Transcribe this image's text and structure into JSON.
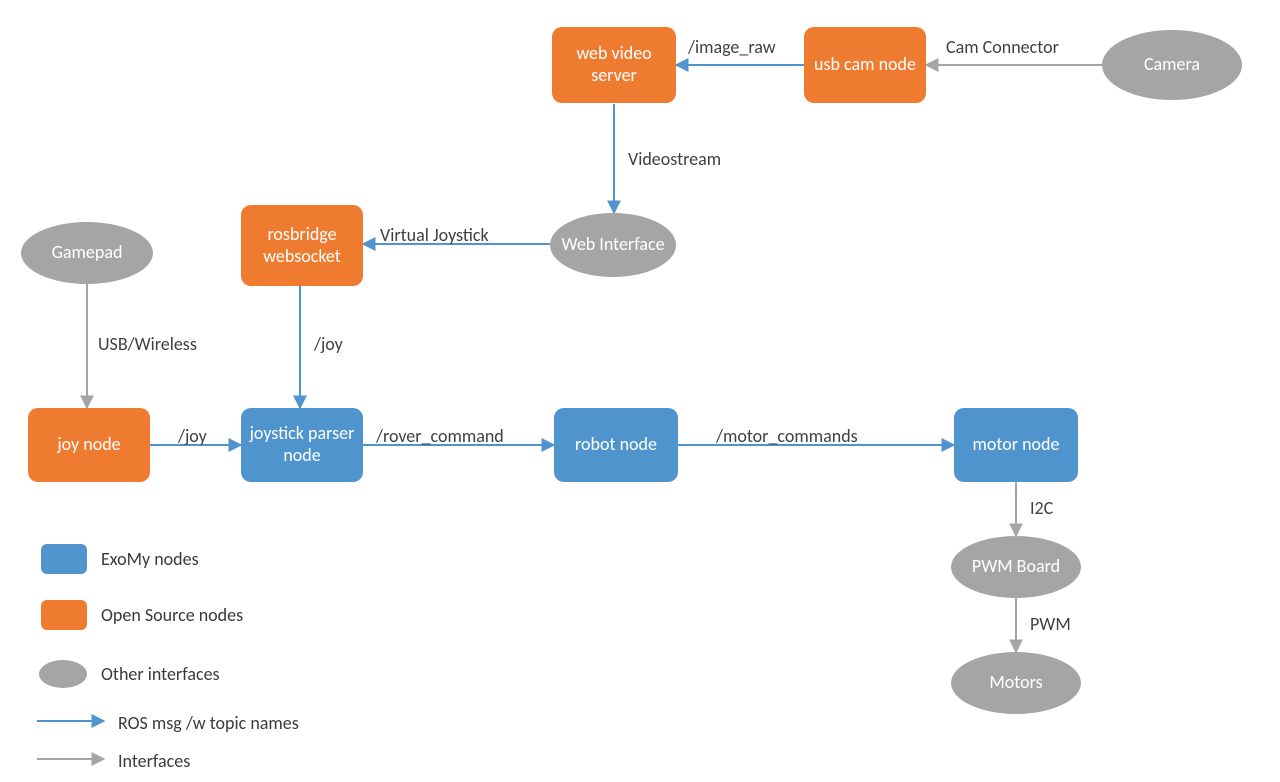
{
  "nodes": {
    "web_video_server": "web video server",
    "usb_cam_node": "usb cam node",
    "camera": "Camera",
    "web_interface": "Web Interface",
    "rosbridge": "rosbridge websocket",
    "gamepad": "Gamepad",
    "joy_node": "joy node",
    "joystick_parser": "joystick parser node",
    "robot_node": "robot node",
    "motor_node": "motor node",
    "pwm_board": "PWM Board",
    "motors": "Motors"
  },
  "labels": {
    "image_raw": "/image_raw",
    "cam_connector": "Cam Connector",
    "videostream": "Videostream",
    "virtual_joystick": "Virtual Joystick",
    "usb_wireless": "USB/Wireless",
    "joy1": "/joy",
    "joy2": "/joy",
    "rover_command": "/rover_command",
    "motor_commands": "/motor_commands",
    "i2c": "I2C",
    "pwm": "PWM"
  },
  "legend": {
    "exomy": "ExoMy nodes",
    "opensource": "Open Source nodes",
    "other": "Other interfaces",
    "ros": "ROS msg /w topic names",
    "interfaces": "Interfaces"
  },
  "colors": {
    "blue": "#4f94cd",
    "orange": "#ee7b30",
    "gray": "#a5a5a5",
    "arrow_blue": "#4f94cd",
    "arrow_gray": "#a5a5a5"
  }
}
